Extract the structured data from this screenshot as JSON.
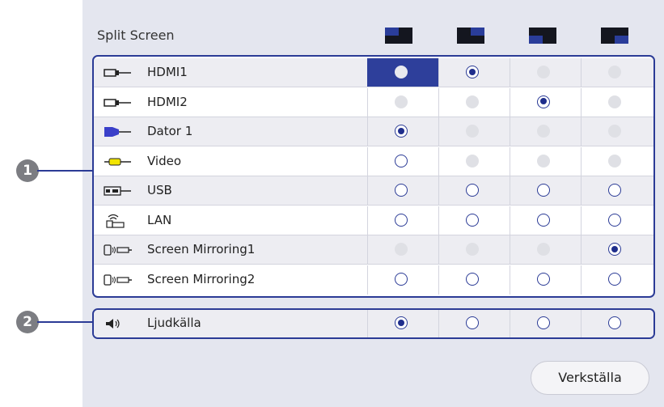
{
  "header": {
    "title": "Split Screen",
    "layout_icons": [
      "layout-top-left-icon",
      "layout-top-right-icon",
      "layout-bottom-left-icon",
      "layout-bottom-right-icon"
    ]
  },
  "callouts": [
    "1",
    "2"
  ],
  "sources": [
    {
      "label": "HDMI1",
      "icon": "hdmi-icon",
      "states": [
        "highlight",
        "checked",
        "disabled",
        "disabled"
      ]
    },
    {
      "label": "HDMI2",
      "icon": "hdmi-icon",
      "states": [
        "disabled",
        "disabled",
        "checked",
        "disabled"
      ]
    },
    {
      "label": "Dator 1",
      "icon": "computer-icon",
      "states": [
        "checked",
        "disabled",
        "disabled",
        "disabled"
      ]
    },
    {
      "label": "Video",
      "icon": "video-icon",
      "states": [
        "empty",
        "disabled",
        "disabled",
        "disabled"
      ]
    },
    {
      "label": "USB",
      "icon": "usb-icon",
      "states": [
        "empty",
        "empty",
        "empty",
        "empty"
      ]
    },
    {
      "label": "LAN",
      "icon": "lan-icon",
      "states": [
        "empty",
        "empty",
        "empty",
        "empty"
      ]
    },
    {
      "label": "Screen Mirroring1",
      "icon": "screen-mirroring-icon",
      "states": [
        "disabled",
        "disabled",
        "disabled",
        "checked"
      ]
    },
    {
      "label": "Screen Mirroring2",
      "icon": "screen-mirroring-icon",
      "states": [
        "empty",
        "empty",
        "empty",
        "empty"
      ]
    }
  ],
  "audio": {
    "label": "Ljudkälla",
    "icon": "speaker-icon",
    "states": [
      "checked",
      "empty",
      "empty",
      "empty"
    ]
  },
  "apply_button": "Verkställa",
  "colors": {
    "accent": "#2b3b96",
    "selected_cell": "#2e3f9b",
    "panel_bg": "#e4e6ef"
  }
}
